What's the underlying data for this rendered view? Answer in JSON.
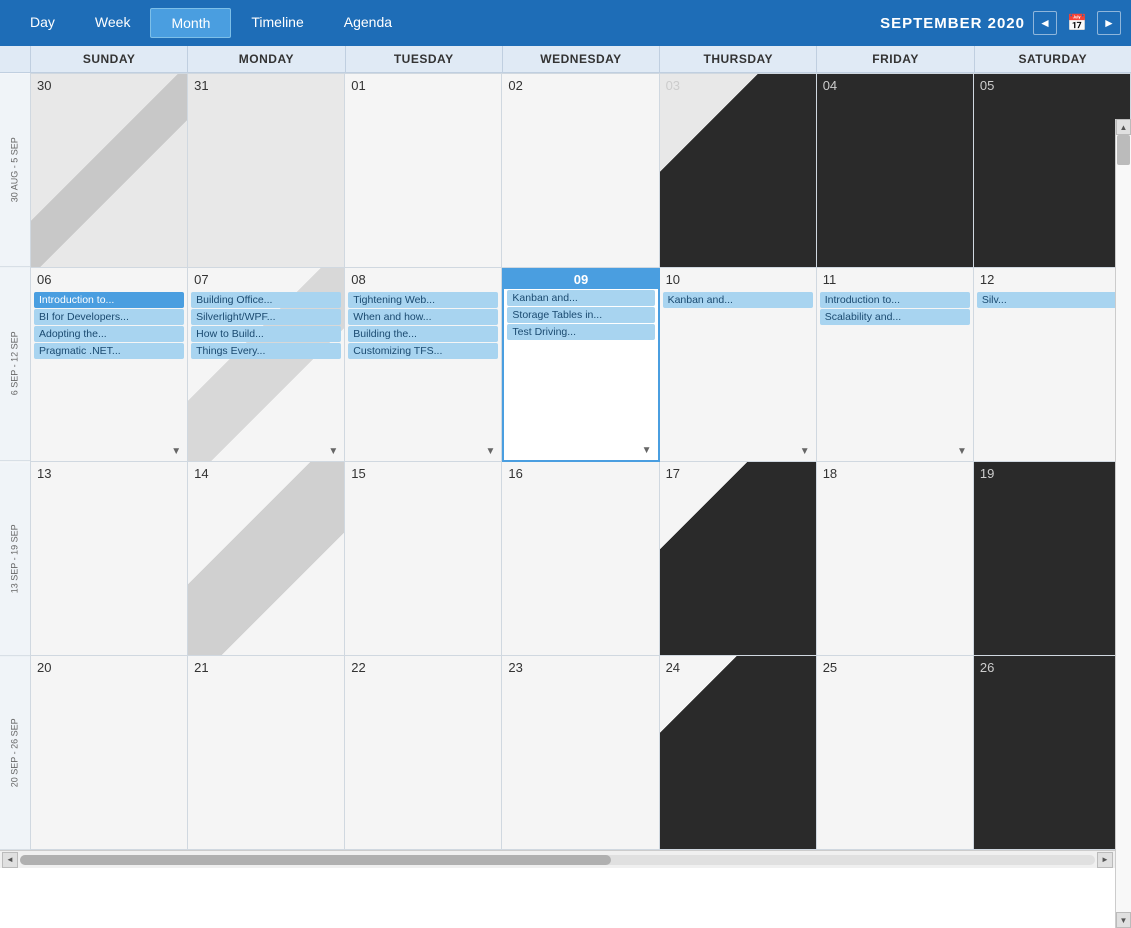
{
  "header": {
    "tabs": [
      "Day",
      "Week",
      "Month",
      "Timeline",
      "Agenda"
    ],
    "active_tab": "Month",
    "month_year": "SEPTEMBER 2020",
    "prev_label": "◄",
    "next_label": "►",
    "calendar_icon": "📅"
  },
  "day_headers": [
    "SUNDAY",
    "MONDAY",
    "TUESDAY",
    "WEDNESDAY",
    "THURSDAY",
    "FRIDAY",
    "SATURDAY"
  ],
  "week_labels": [
    "30 AUG - 5 SEP",
    "6 SEP - 12 SEP",
    "13 SEP - 19 SEP",
    "20 SEP - 26 SEP"
  ],
  "weeks": [
    {
      "days": [
        {
          "date": "30",
          "type": "other-month",
          "style": "light-diag"
        },
        {
          "date": "31",
          "type": "other-month",
          "style": "light"
        },
        {
          "date": "01",
          "type": "current-month",
          "style": "light"
        },
        {
          "date": "02",
          "type": "current-month",
          "style": "light"
        },
        {
          "date": "03",
          "type": "dark",
          "style": "dark"
        },
        {
          "date": "04",
          "type": "dark",
          "style": "dark"
        },
        {
          "date": "05",
          "type": "dark",
          "style": "dark"
        }
      ]
    },
    {
      "days": [
        {
          "date": "06",
          "type": "current-month",
          "style": "light",
          "events": [
            {
              "label": "Introduction to...",
              "color": "blue"
            },
            {
              "label": "BI for Developers...",
              "color": "light-blue"
            },
            {
              "label": "Adopting the...",
              "color": "light-blue"
            },
            {
              "label": "Pragmatic .NET...",
              "color": "light-blue"
            }
          ],
          "more": true
        },
        {
          "date": "07",
          "type": "current-month",
          "style": "light-diag",
          "events": [
            {
              "label": "Building Office...",
              "color": "light-blue"
            },
            {
              "label": "Silverlight/WPF...",
              "color": "light-blue"
            },
            {
              "label": "How to Build...",
              "color": "light-blue"
            },
            {
              "label": "Things Every...",
              "color": "light-blue"
            }
          ],
          "more": true
        },
        {
          "date": "08",
          "type": "current-month",
          "style": "light",
          "events": [
            {
              "label": "Tightening Web...",
              "color": "light-blue"
            },
            {
              "label": "When and how...",
              "color": "light-blue"
            },
            {
              "label": "Building the...",
              "color": "light-blue"
            },
            {
              "label": "Customizing TFS...",
              "color": "light-blue"
            }
          ],
          "more": true
        },
        {
          "date": "09",
          "type": "selected-today",
          "style": "selected",
          "events": [
            {
              "label": "Kanban and...",
              "color": "light-blue"
            },
            {
              "label": "Storage Tables in...",
              "color": "light-blue"
            },
            {
              "label": "Test Driving...",
              "color": "light-blue"
            }
          ],
          "more": true
        },
        {
          "date": "10",
          "type": "current-month",
          "style": "light",
          "events": [
            {
              "label": "Kanban and...",
              "color": "light-blue"
            }
          ],
          "more": true
        },
        {
          "date": "11",
          "type": "current-month",
          "style": "light",
          "events": [
            {
              "label": "Introduction to...",
              "color": "light-blue"
            },
            {
              "label": "Scalability and...",
              "color": "light-blue"
            }
          ],
          "more": true
        },
        {
          "date": "12",
          "type": "current-month",
          "style": "light",
          "events": [
            {
              "label": "Silv...",
              "color": "light-blue"
            }
          ]
        }
      ]
    },
    {
      "days": [
        {
          "date": "13",
          "type": "current-month",
          "style": "light"
        },
        {
          "date": "14",
          "type": "current-month",
          "style": "light-diag"
        },
        {
          "date": "15",
          "type": "current-month",
          "style": "light"
        },
        {
          "date": "16",
          "type": "current-month",
          "style": "light"
        },
        {
          "date": "17",
          "type": "dark",
          "style": "dark"
        },
        {
          "date": "18",
          "type": "current-month",
          "style": "light"
        },
        {
          "date": "19",
          "type": "dark",
          "style": "dark"
        }
      ]
    },
    {
      "days": [
        {
          "date": "20",
          "type": "current-month",
          "style": "light"
        },
        {
          "date": "21",
          "type": "current-month",
          "style": "light"
        },
        {
          "date": "22",
          "type": "current-month",
          "style": "light"
        },
        {
          "date": "23",
          "type": "current-month",
          "style": "light"
        },
        {
          "date": "24",
          "type": "dark",
          "style": "dark"
        },
        {
          "date": "25",
          "type": "current-month",
          "style": "light"
        },
        {
          "date": "26",
          "type": "dark",
          "style": "dark"
        }
      ]
    }
  ],
  "more_indicator": "▼",
  "colors": {
    "header_bg": "#1e6db7",
    "active_tab_bg": "#4a9ee0",
    "day_header_bg": "#dce8f5",
    "event_blue": "#4a9ee0",
    "event_light_blue": "#a8d4f0",
    "cell_light": "#f5f5f5",
    "cell_other": "#e8e8e8",
    "cell_dark": "#2d2d2d"
  }
}
